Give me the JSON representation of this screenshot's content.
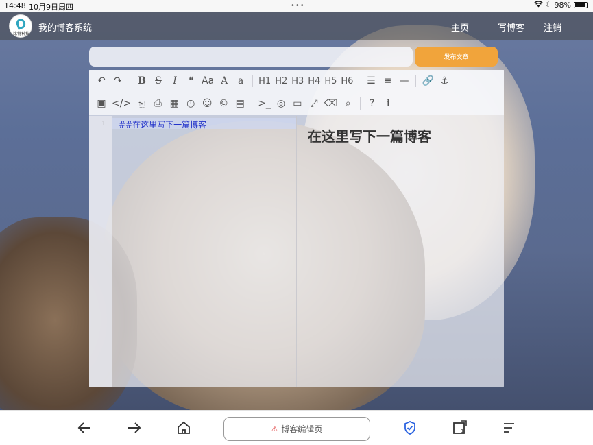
{
  "statusbar": {
    "time": "14:48",
    "date": "10月9日周四",
    "battery": "98%",
    "handle": "•••"
  },
  "header": {
    "logo_text": "比特科技",
    "site_title": "我的博客系统",
    "nav": [
      "主页",
      "写博客",
      "注销"
    ]
  },
  "editor_page": {
    "title_placeholder": "",
    "publish_label": "发布文章"
  },
  "toolbar": {
    "row1": [
      {
        "name": "undo-icon",
        "glyph": "↶"
      },
      {
        "name": "redo-icon",
        "glyph": "↷"
      },
      {
        "sep": true
      },
      {
        "name": "bold-icon",
        "glyph": "B"
      },
      {
        "name": "strikethrough-icon",
        "glyph": "S"
      },
      {
        "name": "italic-icon",
        "glyph": "I"
      },
      {
        "name": "quote-icon",
        "glyph": "❝"
      },
      {
        "name": "uppercase-icon",
        "glyph": "Aa"
      },
      {
        "name": "uppercase-first-icon",
        "glyph": "A"
      },
      {
        "name": "lowercase-icon",
        "glyph": "a"
      },
      {
        "sep": true
      },
      {
        "name": "h1-button",
        "glyph": "H1"
      },
      {
        "name": "h2-button",
        "glyph": "H2"
      },
      {
        "name": "h3-button",
        "glyph": "H3"
      },
      {
        "name": "h4-button",
        "glyph": "H4"
      },
      {
        "name": "h5-button",
        "glyph": "H5"
      },
      {
        "name": "h6-button",
        "glyph": "H6"
      },
      {
        "sep": true
      },
      {
        "name": "unordered-list-icon",
        "glyph": "☰"
      },
      {
        "name": "ordered-list-icon",
        "glyph": "≡"
      },
      {
        "name": "horizontal-rule-icon",
        "glyph": "—"
      },
      {
        "sep": true
      },
      {
        "name": "link-icon",
        "glyph": "🔗"
      },
      {
        "name": "anchor-icon",
        "glyph": "⚓"
      }
    ],
    "row2": [
      {
        "name": "image-icon",
        "glyph": "▣"
      },
      {
        "name": "inline-code-icon",
        "glyph": "</>"
      },
      {
        "name": "code-block-icon",
        "glyph": "⎘"
      },
      {
        "name": "preformatted-text-icon",
        "glyph": "⎙"
      },
      {
        "name": "table-icon",
        "glyph": "▦"
      },
      {
        "name": "datetime-icon",
        "glyph": "◷"
      },
      {
        "name": "emoji-icon",
        "glyph": "☺"
      },
      {
        "name": "html-entities-icon",
        "glyph": "©"
      },
      {
        "name": "pagebreak-icon",
        "glyph": "▤"
      },
      {
        "sep": true
      },
      {
        "name": "goto-line-icon",
        "glyph": ">_"
      },
      {
        "name": "toggle-preview-icon",
        "glyph": "◎"
      },
      {
        "name": "watch-icon",
        "glyph": "▭"
      },
      {
        "name": "fullscreen-icon",
        "glyph": "⤢"
      },
      {
        "name": "clear-icon",
        "glyph": "⌫"
      },
      {
        "name": "search-icon",
        "glyph": "⌕"
      },
      {
        "sep": true
      },
      {
        "name": "help-icon",
        "glyph": "?"
      },
      {
        "name": "info-icon",
        "glyph": "ℹ"
      }
    ]
  },
  "code_editor": {
    "line_number": "1",
    "content": "##在这里写下一篇博客"
  },
  "preview": {
    "heading": "在这里写下一篇博客"
  },
  "bottombar": {
    "url_label": "博客编辑页",
    "url_warning_icon": "⚠"
  }
}
